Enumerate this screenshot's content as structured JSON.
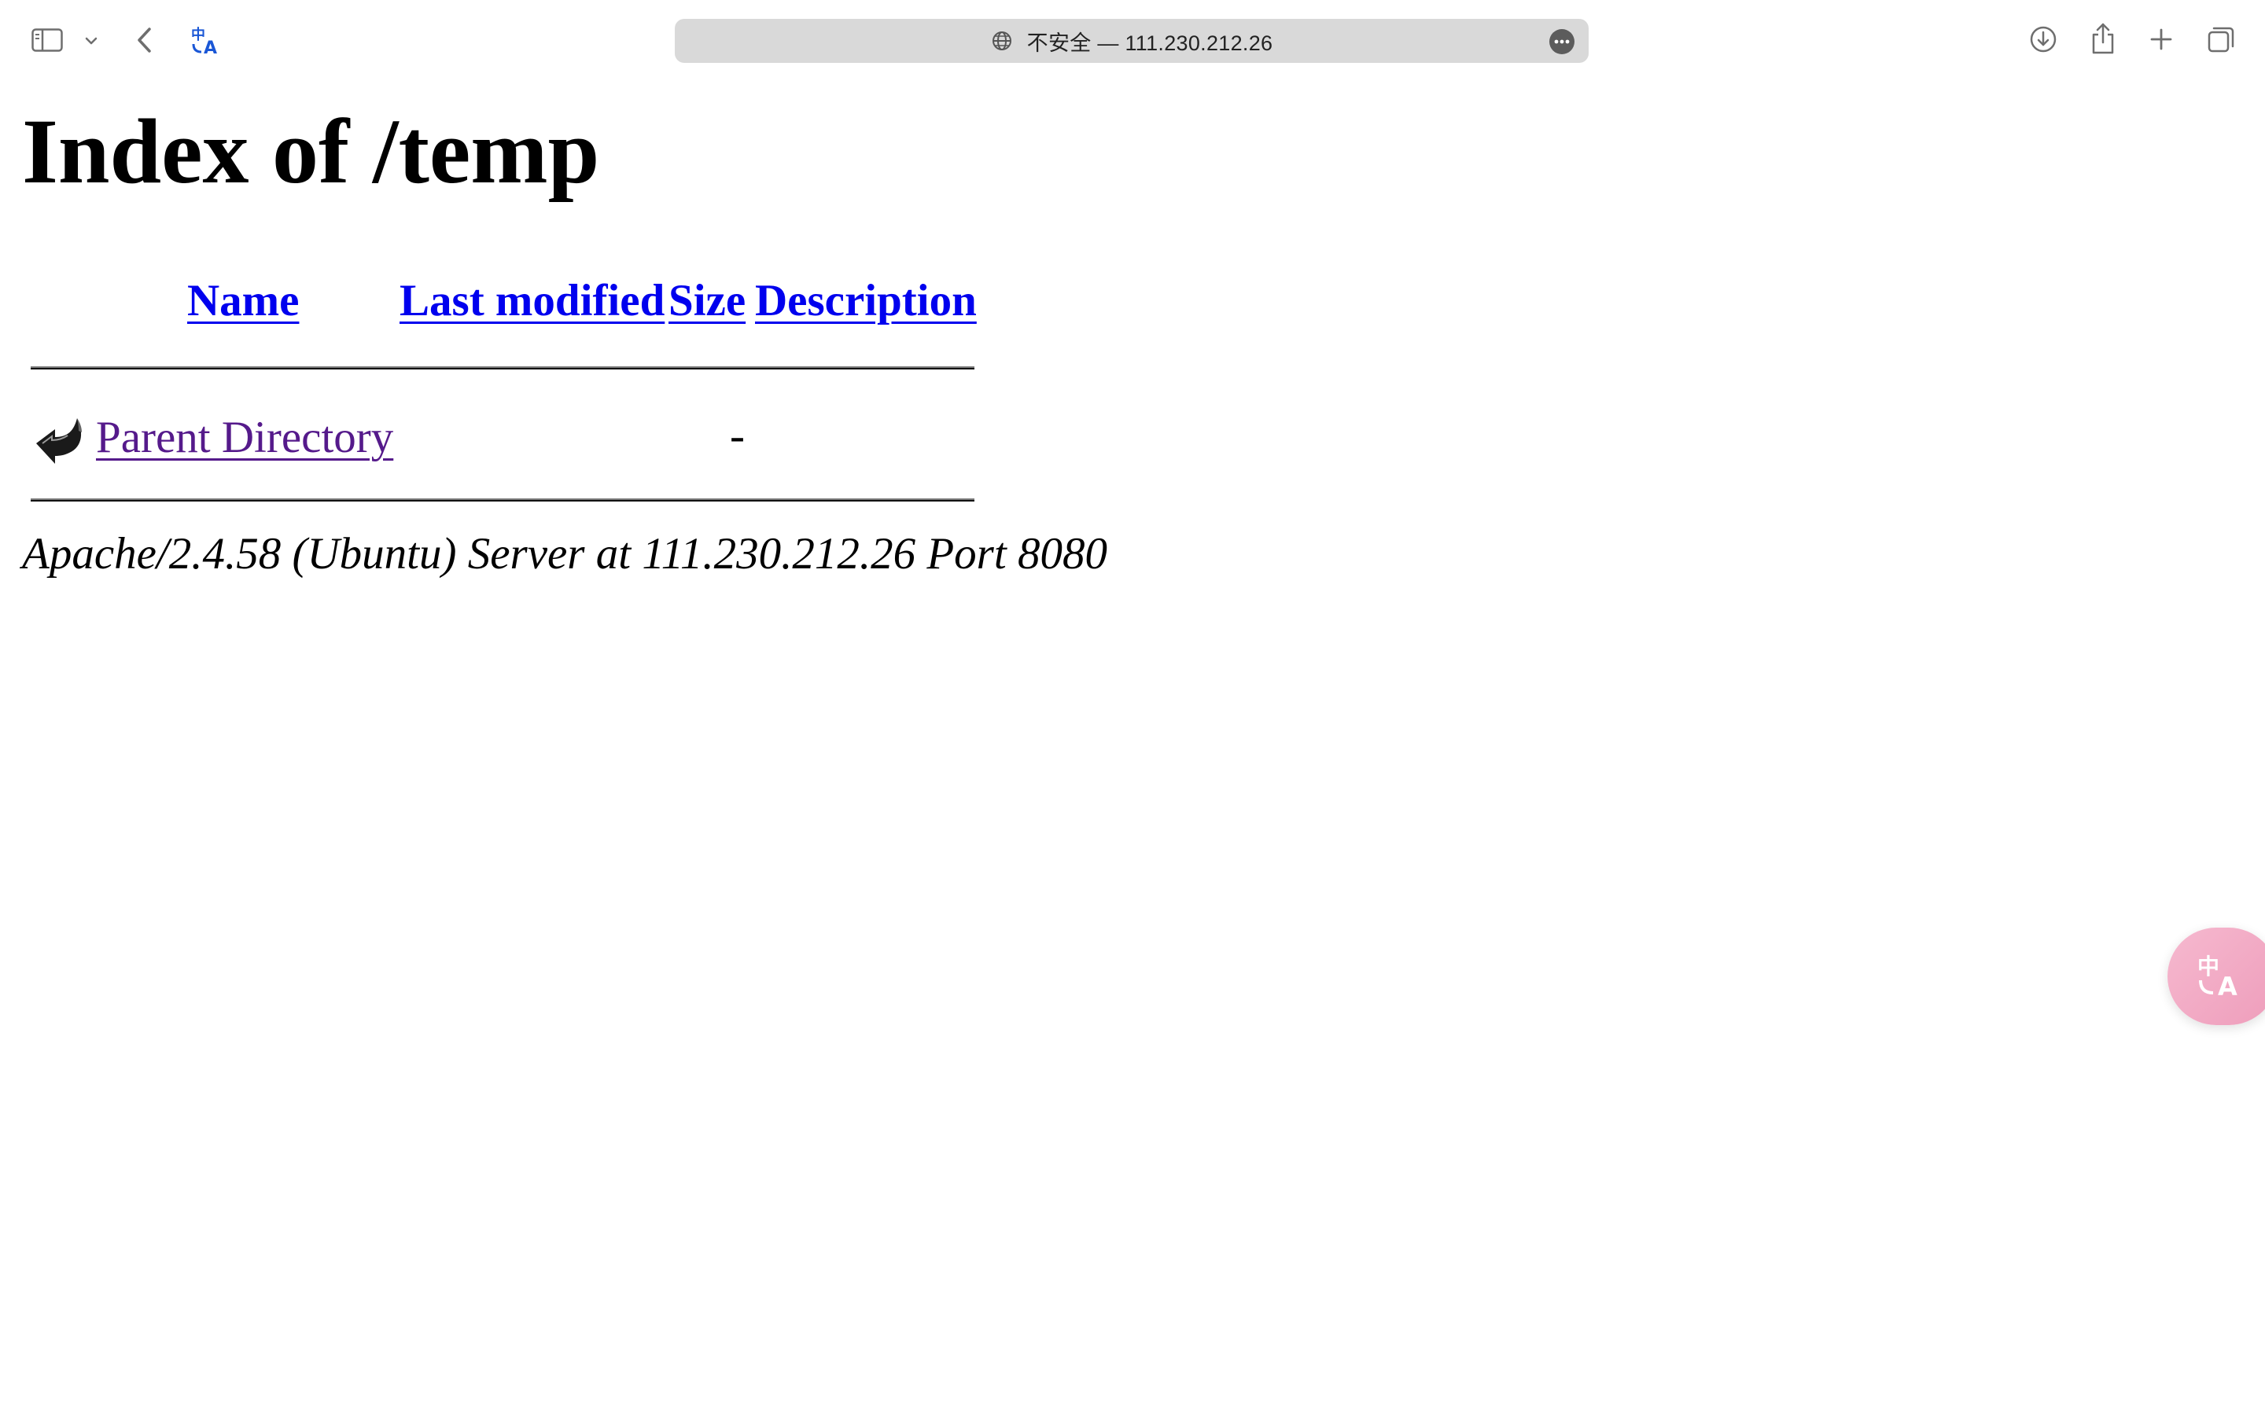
{
  "browser": {
    "address_bar": {
      "text": "不安全 — 111.230.212.26"
    }
  },
  "page": {
    "title": "Index of /temp",
    "columns": {
      "name": "Name",
      "last_modified": "Last modified",
      "size": "Size",
      "description": "Description"
    },
    "rows": [
      {
        "name": "Parent Directory",
        "last_modified": "",
        "size": "-",
        "description": "",
        "icon": "back-arrow-icon"
      }
    ],
    "address_footer": "Apache/2.4.58 (Ubuntu) Server at 111.230.212.26 Port 8080"
  },
  "colors": {
    "link": "#0000ee",
    "visited_link": "#551a8b",
    "address_bar_bg": "#d9d9d9",
    "translate_accent": "#1a57d6",
    "translate_fab": "#f0a8c4"
  }
}
